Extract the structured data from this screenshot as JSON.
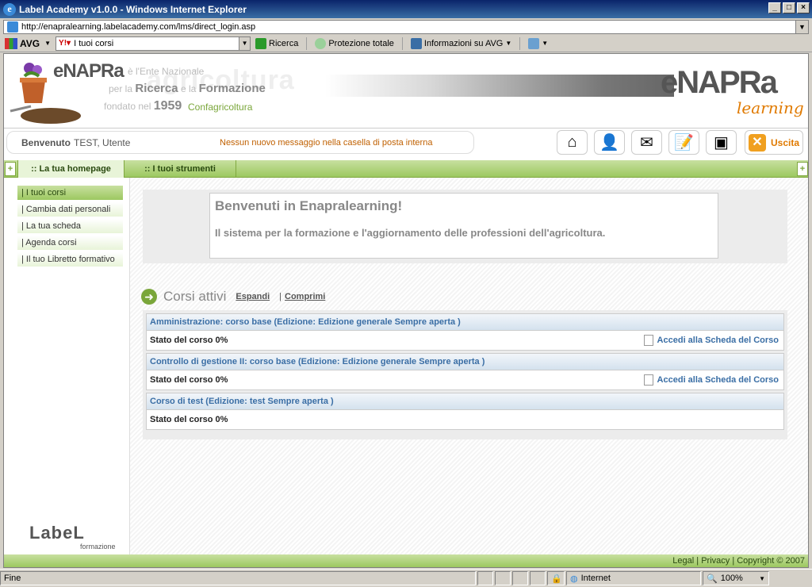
{
  "window": {
    "title": "Label Academy v1.0.0 - Windows Internet Explorer"
  },
  "address": {
    "url": "http://enapralearning.labelacademy.com/lms/direct_login.asp"
  },
  "toolbar": {
    "avg_label": "AVG",
    "search_value": "I tuoi corsi",
    "search_button": "Ricerca",
    "protection": "Protezione totale",
    "info": "Informazioni su AVG"
  },
  "brand": {
    "small_logo": "eNAPRa",
    "tagline1": "è l'Ente Nazionale",
    "tagline2a": "per la",
    "tagline2b": "Ricerca",
    "tagline2c": "e la",
    "tagline2d": "Formazione",
    "tagline3a": "fondato nel",
    "tagline3b": "1959",
    "ghost": "agricoltura",
    "confag": "Confagricoltura",
    "big_logo": "eNAPRa",
    "learning": "learning"
  },
  "welcome": {
    "greeting": "Benvenuto",
    "user": "TEST, Utente",
    "message": "Nessun nuovo messaggio nella casella di posta interna"
  },
  "actions": {
    "logout": "Uscita"
  },
  "tabs": [
    ":: La tua homepage",
    ":: I tuoi strumenti"
  ],
  "sidebar": {
    "items": [
      "| I tuoi corsi",
      "| Cambia dati personali",
      "| La tua scheda",
      "| Agenda corsi",
      "| Il tuo Libretto formativo"
    ],
    "footer_logo": "LabeL",
    "footer_sub": "formazione"
  },
  "main": {
    "welcome_title": "Benvenuti in Enapralearning!",
    "welcome_text": "Il sistema per la formazione e l'aggiornamento delle professioni dell'agricoltura.",
    "active_courses": "Corsi attivi",
    "expand": "Espandi",
    "collapse_sep": "|",
    "collapse": "Comprimi",
    "courses": [
      {
        "title": "Amministrazione: corso base (Edizione: Edizione generale Sempre aperta )",
        "status": "Stato del corso 0%",
        "link": "Accedi alla Scheda del Corso"
      },
      {
        "title": "Controllo di gestione II: corso base (Edizione: Edizione generale Sempre aperta )",
        "status": "Stato del corso 0%",
        "link": "Accedi alla Scheda del Corso"
      },
      {
        "title": "Corso di test (Edizione: test Sempre aperta )",
        "status": "Stato del corso 0%",
        "link": ""
      }
    ]
  },
  "footer": {
    "legal": "Legal",
    "privacy": "Privacy",
    "copyright": "Copyright © 2007",
    "sep": "|"
  },
  "statusbar": {
    "left": "Fine",
    "zone": "Internet",
    "zoom": "100%"
  }
}
